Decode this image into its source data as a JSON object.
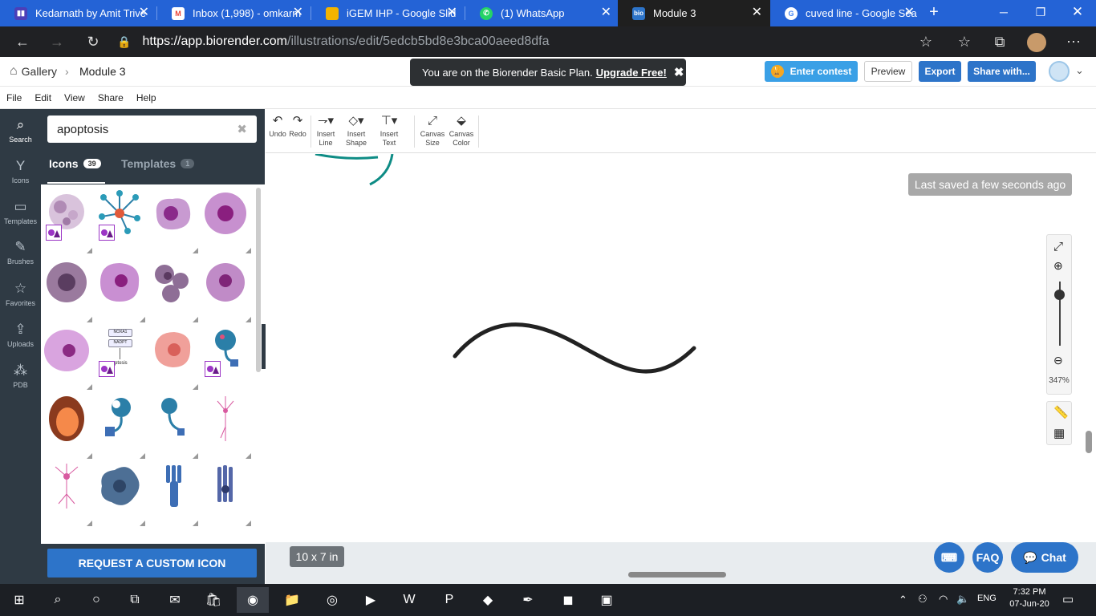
{
  "browser": {
    "tabs": [
      {
        "title": "Kedarnath by Amit Trive",
        "favicon": "trello-icon",
        "color": "#4b3fb8",
        "active": false
      },
      {
        "title": "Inbox (1,998) - omkarm",
        "favicon": "gmail-icon",
        "color": "#ea4335",
        "active": false
      },
      {
        "title": "iGEM IHP - Google Slid",
        "favicon": "slides-icon",
        "color": "#f4b400",
        "active": false
      },
      {
        "title": "(1) WhatsApp",
        "favicon": "whatsapp-icon",
        "color": "#25d366",
        "active": false
      },
      {
        "title": "Module 3",
        "favicon": "biorender-icon",
        "color": "#2d74c9",
        "active": true
      },
      {
        "title": "cuved line - Google Sea",
        "favicon": "google-icon",
        "color": "#ffffff",
        "active": false
      }
    ],
    "url_host": "https://app.biorender.com",
    "url_path": "/illustrations/edit/5edcb5bd8e3bca00aeed8dfa"
  },
  "header": {
    "gallery_label": "Gallery",
    "breadcrumb_current": "Module 3",
    "toast_text": "You are on the Biorender Basic Plan.",
    "toast_link": "Upgrade Free!",
    "enter_contest": "Enter contest",
    "preview": "Preview",
    "export": "Export",
    "share": "Share with..."
  },
  "menu": [
    "File",
    "Edit",
    "View",
    "Share",
    "Help"
  ],
  "rail": [
    {
      "label": "Search",
      "icon": "search-icon"
    },
    {
      "label": "Icons",
      "icon": "icons-icon"
    },
    {
      "label": "Templates",
      "icon": "templates-icon"
    },
    {
      "label": "Brushes",
      "icon": "brush-icon"
    },
    {
      "label": "Favorites",
      "icon": "star-icon"
    },
    {
      "label": "Uploads",
      "icon": "upload-icon"
    },
    {
      "label": "PDB",
      "icon": "pdb-icon"
    }
  ],
  "panel": {
    "search_value": "apoptosis",
    "icons_tab": "Icons",
    "icons_count": "39",
    "templates_tab": "Templates",
    "templates_count": "1",
    "custom_icon_button": "REQUEST A CUSTOM ICON",
    "icon_card_text_1": "NOXA1",
    "icon_card_text_2": "NADPT",
    "icon_card_text_3": "apoptosis"
  },
  "toolbar": {
    "undo": "Undo",
    "redo": "Redo",
    "insert_line": [
      "Insert",
      "Line"
    ],
    "insert_shape": [
      "Insert",
      "Shape"
    ],
    "insert_text": [
      "Insert",
      "Text"
    ],
    "canvas_size": [
      "Canvas",
      "Size"
    ],
    "canvas_color": [
      "Canvas",
      "Color"
    ]
  },
  "canvas": {
    "saved_status": "Last saved a few seconds ago",
    "zoom_percent": "347%",
    "canvas_dimensions": "10 x 7 in"
  },
  "help": {
    "faq": "FAQ",
    "chat": "Chat"
  },
  "taskbar": {
    "time": "7:32 PM",
    "date": "07-Jun-20",
    "lang": "ENG"
  }
}
